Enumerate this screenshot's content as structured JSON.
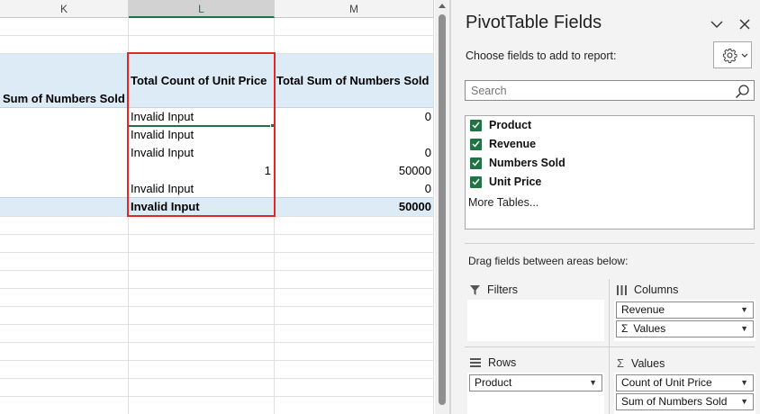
{
  "sheet": {
    "columns": [
      "K",
      "L",
      "M"
    ],
    "headers": {
      "k": "Sum of Numbers Sold",
      "l": "Total Count of Unit Price",
      "m": "Total Sum of Numbers Sold"
    },
    "rows": [
      {
        "l": "Invalid Input",
        "m": "0"
      },
      {
        "l": "Invalid Input",
        "m": ""
      },
      {
        "l": "Invalid Input",
        "m": "0"
      },
      {
        "l": "1",
        "m": "50000"
      },
      {
        "l": "Invalid Input",
        "m": "0"
      }
    ],
    "total_row": {
      "l": "Invalid Input",
      "m": "50000"
    }
  },
  "pane": {
    "title": "PivotTable Fields",
    "choose_label": "Choose fields to add to report:",
    "search_placeholder": "Search",
    "fields": [
      {
        "label": "Product",
        "checked": true
      },
      {
        "label": "Revenue",
        "checked": true
      },
      {
        "label": "Numbers Sold",
        "checked": true
      },
      {
        "label": "Unit Price",
        "checked": true
      }
    ],
    "more_tables": "More Tables...",
    "drag_label": "Drag fields between areas below:",
    "areas": {
      "filters": {
        "title": "Filters"
      },
      "columns": {
        "title": "Columns",
        "items": [
          "Revenue",
          "Values"
        ]
      },
      "rows": {
        "title": "Rows",
        "items": [
          "Product"
        ]
      },
      "values": {
        "title": "Values",
        "items": [
          "Count of Unit Price",
          "Sum of Numbers Sold"
        ]
      }
    }
  },
  "colors": {
    "accent": "#217346",
    "selection": "#e32626",
    "band": "#ddebf7"
  }
}
